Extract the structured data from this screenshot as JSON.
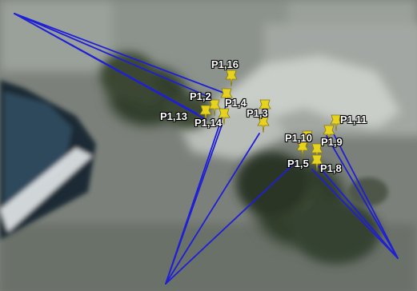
{
  "map": {
    "line_color": "#1f1fd6",
    "pin_color": "#e6d31f"
  },
  "markers": [
    {
      "id": "p1-16",
      "label": "P1,16"
    },
    {
      "id": "p1-2",
      "label": "P1,2"
    },
    {
      "id": "p1-4",
      "label": "P1,4"
    },
    {
      "id": "p1-13",
      "label": "P1,13"
    },
    {
      "id": "p1-14",
      "label": "P1,14"
    },
    {
      "id": "p1-3",
      "label": "P1,3"
    },
    {
      "id": "p1-11",
      "label": "P1,11"
    },
    {
      "id": "p1-10",
      "label": "P1,10"
    },
    {
      "id": "p1-9",
      "label": "P1,9"
    },
    {
      "id": "p1-5",
      "label": "P1,5"
    },
    {
      "id": "p1-8",
      "label": "P1,8"
    }
  ]
}
